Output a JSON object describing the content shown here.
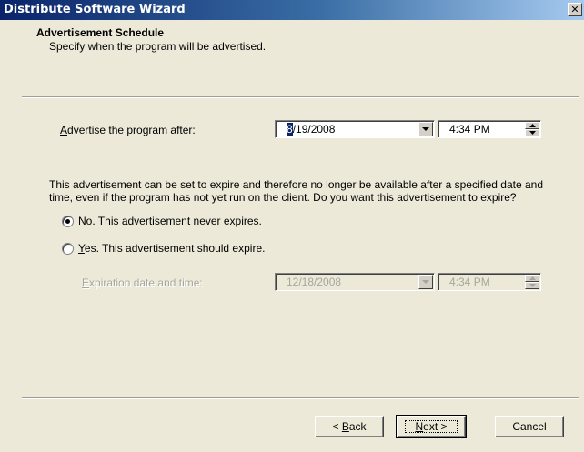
{
  "window": {
    "title": "Distribute Software Wizard",
    "close_glyph": "✕"
  },
  "header": {
    "title": "Advertisement Schedule",
    "subtitle": "Specify when the program will be advertised."
  },
  "advertise": {
    "label_prefix": "A",
    "label_rest": "dvertise the program after:",
    "date_caret": "8",
    "date_rest": "/19/2008",
    "time": "4:34 PM"
  },
  "description": "This advertisement can be set to expire and therefore no longer be available after a specified date and time, even if the program has not yet run on the client. Do you want this advertisement to expire?",
  "options": {
    "no": {
      "pre": "N",
      "mnemonic": "o",
      "post": ". This advertisement never expires.",
      "selected": true
    },
    "yes": {
      "pre": "",
      "mnemonic": "Y",
      "post": "es. This advertisement should expire.",
      "selected": false
    }
  },
  "expiration": {
    "label_prefix": "E",
    "label_rest": "xpiration date and time:",
    "date": "12/18/2008",
    "time": "4:34 PM"
  },
  "buttons": {
    "back": {
      "pre": "< ",
      "mnemonic": "B",
      "post": "ack"
    },
    "next": {
      "pre": "",
      "mnemonic": "N",
      "post": "ext >"
    },
    "cancel": "Cancel"
  }
}
